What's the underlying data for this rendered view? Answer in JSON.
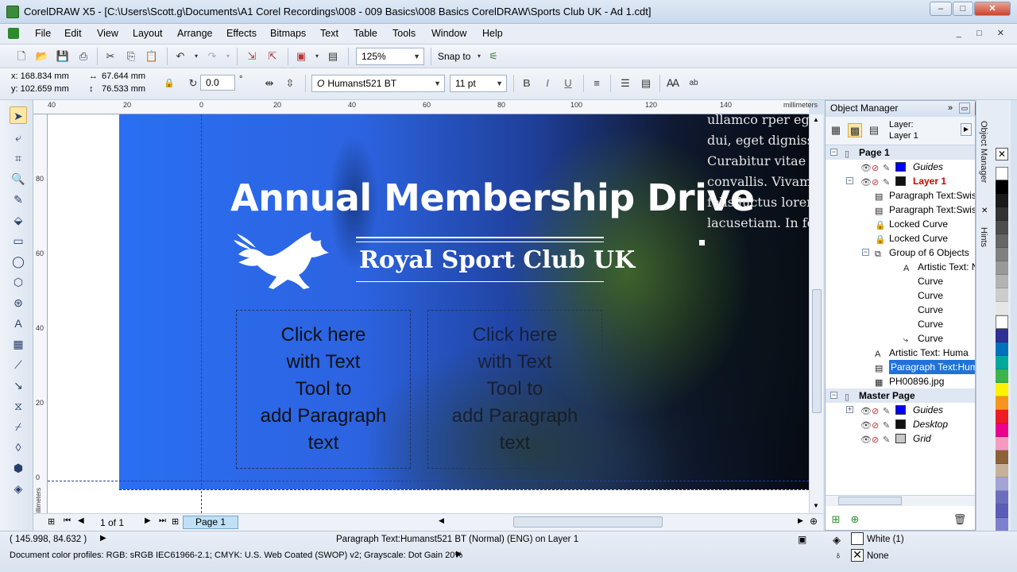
{
  "window": {
    "title": "CorelDRAW X5 - [C:\\Users\\Scott.g\\Documents\\A1  Corel Recordings\\008 - 009 Basics\\008 Basics CorelDRAW\\Sports Club UK - Ad 1.cdt]",
    "minimize": "–",
    "maximize": "□",
    "close": "✕"
  },
  "menu": [
    "File",
    "Edit",
    "View",
    "Layout",
    "Arrange",
    "Effects",
    "Bitmaps",
    "Text",
    "Table",
    "Tools",
    "Window",
    "Help"
  ],
  "toolbar": {
    "zoom": "125%",
    "snap_to": "Snap to"
  },
  "property_bar": {
    "x": "x: 168.834 mm",
    "y": "y: 102.659 mm",
    "width": "67.644 mm",
    "height": "76.533 mm",
    "angle": "0.0",
    "degree": "°",
    "font": "Humanst521 BT",
    "font_size": "11 pt",
    "bold": "B",
    "italic": "I",
    "underline": "U"
  },
  "ruler": {
    "top_ticks": [
      "40",
      "20",
      "0",
      "20",
      "40",
      "60",
      "80",
      "100",
      "120",
      "140"
    ],
    "units": "millimeters",
    "left_ticks": [
      "80",
      "60",
      "40",
      "20",
      "0"
    ],
    "left_units": "millimeters"
  },
  "canvas": {
    "headline": "Annual Membership Drive",
    "club_name": "Royal Sport Club UK",
    "frame1": "Click here\nwith Text\nTool to\nadd Paragraph\ntext",
    "frame2": "Click here\nwith Text\nTool to\nadd Paragraph\ntext",
    "latin": "ullamco rper egta\ndui, eget dignissin\nCurabitur vitae le\nconvallis. Vivamus\nfelis luctus lorem\nlacusetiam. In felis"
  },
  "object_manager": {
    "title": "Object Manager",
    "layer_label": "Layer:",
    "layer_value": "Layer 1",
    "rows": [
      {
        "label": "Page 1",
        "indent": 0,
        "type": "page"
      },
      {
        "label": "Guides",
        "indent": 1,
        "type": "layer",
        "color": "#0000ff"
      },
      {
        "label": "Layer 1",
        "indent": 1,
        "type": "layer",
        "color": "#111111",
        "red": true
      },
      {
        "label": "Paragraph Text:Swiss",
        "indent": 2
      },
      {
        "label": "Paragraph Text:Swiss",
        "indent": 2
      },
      {
        "label": "Locked Curve",
        "indent": 2
      },
      {
        "label": "Locked Curve",
        "indent": 2
      },
      {
        "label": "Group of 6 Objects",
        "indent": 2
      },
      {
        "label": "Artistic Text: Ne",
        "indent": 3
      },
      {
        "label": "Curve",
        "indent": 3
      },
      {
        "label": "Curve",
        "indent": 3
      },
      {
        "label": "Curve",
        "indent": 3
      },
      {
        "label": "Curve",
        "indent": 3
      },
      {
        "label": "Curve",
        "indent": 3
      },
      {
        "label": "Artistic Text: Huma",
        "indent": 2
      },
      {
        "label": "Paragraph Text:Hum",
        "indent": 2,
        "selected": true
      },
      {
        "label": "PH00896.jpg",
        "indent": 2
      },
      {
        "label": "Master Page",
        "indent": 0,
        "type": "page"
      },
      {
        "label": "Guides",
        "indent": 1,
        "type": "layer",
        "color": "#0000ff"
      },
      {
        "label": "Desktop",
        "indent": 1,
        "type": "layer",
        "color": "#111111"
      },
      {
        "label": "Grid",
        "indent": 1,
        "type": "layer",
        "color": "#c8c8c8"
      }
    ]
  },
  "docker_tabs": [
    "Object Manager",
    "Hints"
  ],
  "palette": [
    "#ffffff",
    "#000000",
    "#1a1a1a",
    "#333333",
    "#4d4d4d",
    "#666666",
    "#808080",
    "#999999",
    "#b3b3b3",
    "#cccccc",
    "#e6e6e6",
    "#ffffff",
    "#2e3192",
    "#0072bc",
    "#00a99d",
    "#39b54a",
    "#fff200",
    "#f7941d",
    "#ed1c24",
    "#ec008c",
    "#f49ac1",
    "#8c6239",
    "#c7b299",
    "#a3a3d6",
    "#6d6dc0",
    "#5c5cb8",
    "#7f7fd0"
  ],
  "page_nav": {
    "count": "1 of 1",
    "tab": "Page 1"
  },
  "status": {
    "coords": "( 145.998, 84.632 )",
    "object_info": "Paragraph Text:Humanst521 BT (Normal) (ENG) on Layer 1",
    "color_profiles": "Document color profiles: RGB: sRGB IEC61966-2.1; CMYK: U.S. Web Coated (SWOP) v2; Grayscale: Dot Gain 20%",
    "fill": "White (1)",
    "outline": "None"
  }
}
